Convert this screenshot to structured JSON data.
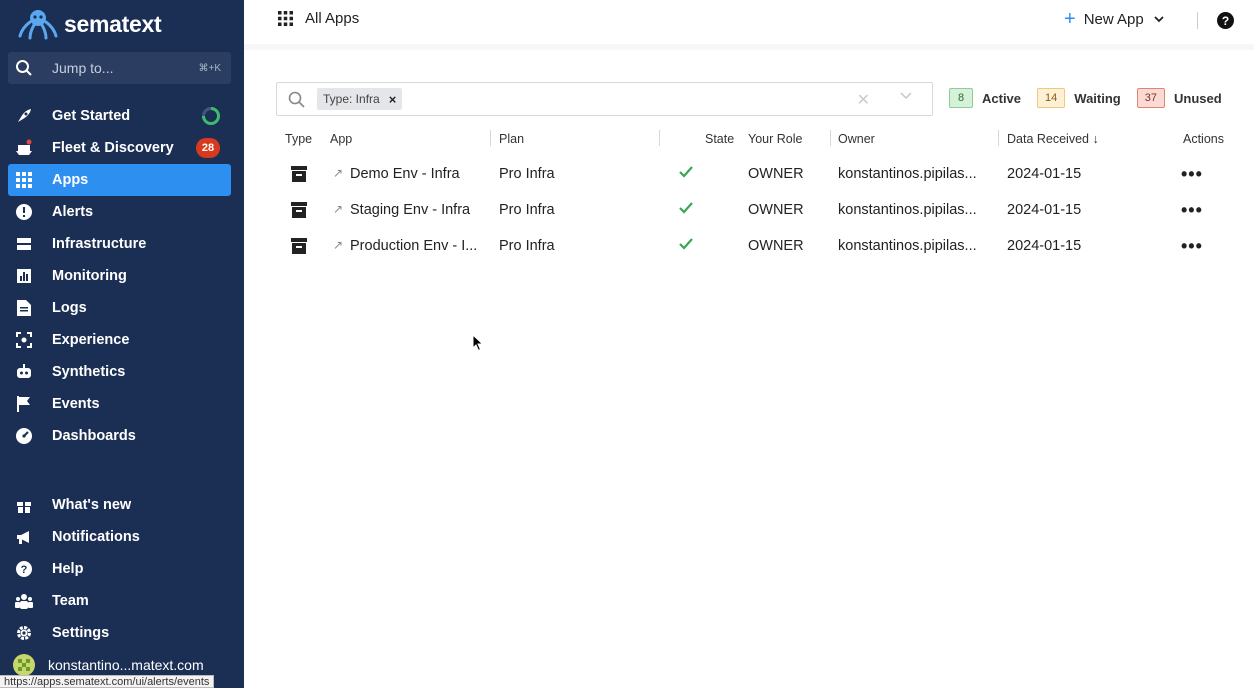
{
  "sidebar": {
    "brand": "sematext",
    "jump": {
      "placeholder": "Jump to...",
      "shortcut": "⌘+K"
    },
    "nav": [
      {
        "label": "Get Started",
        "icon": "rocket-icon"
      },
      {
        "label": "Fleet & Discovery",
        "icon": "ship-icon",
        "badge": "28"
      },
      {
        "label": "Apps",
        "icon": "grid-icon",
        "active": true
      },
      {
        "label": "Alerts",
        "icon": "alert-icon"
      },
      {
        "label": "Infrastructure",
        "icon": "server-icon"
      },
      {
        "label": "Monitoring",
        "icon": "bar-chart-icon"
      },
      {
        "label": "Logs",
        "icon": "document-icon"
      },
      {
        "label": "Experience",
        "icon": "scan-icon"
      },
      {
        "label": "Synthetics",
        "icon": "robot-icon"
      },
      {
        "label": "Events",
        "icon": "flag-icon"
      },
      {
        "label": "Dashboards",
        "icon": "gauge-icon"
      }
    ],
    "bottom_nav": [
      {
        "label": "What's new",
        "icon": "gift-icon"
      },
      {
        "label": "Notifications",
        "icon": "megaphone-icon"
      },
      {
        "label": "Help",
        "icon": "help-icon"
      },
      {
        "label": "Team",
        "icon": "team-icon"
      },
      {
        "label": "Settings",
        "icon": "gear-icon"
      }
    ],
    "user": "konstantino...matext.com"
  },
  "status_url": "https://apps.sematext.com/ui/alerts/events",
  "header": {
    "title": "All Apps",
    "new_app": "New App"
  },
  "filter": {
    "chip": "Type: Infra"
  },
  "legend": [
    {
      "count": "8",
      "label": "Active"
    },
    {
      "count": "14",
      "label": "Waiting"
    },
    {
      "count": "37",
      "label": "Unused"
    }
  ],
  "table": {
    "headers": {
      "type": "Type",
      "app": "App",
      "plan": "Plan",
      "state": "State",
      "role": "Your Role",
      "owner": "Owner",
      "received": "Data Received ↓",
      "actions": "Actions"
    },
    "rows": [
      {
        "app": "Demo Env - Infra",
        "plan": "Pro Infra",
        "role": "OWNER",
        "owner": "konstantinos.pipilas...",
        "received": "2024-01-15"
      },
      {
        "app": "Staging Env - Infra",
        "plan": "Pro Infra",
        "role": "OWNER",
        "owner": "konstantinos.pipilas...",
        "received": "2024-01-15"
      },
      {
        "app": "Production Env - I...",
        "plan": "Pro Infra",
        "role": "OWNER",
        "owner": "konstantinos.pipilas...",
        "received": "2024-01-15"
      }
    ]
  },
  "colors": {
    "sidebar": "#1b2f55",
    "active": "#2d8ff0",
    "badge": "#d93a1e",
    "check": "#3aa655"
  }
}
